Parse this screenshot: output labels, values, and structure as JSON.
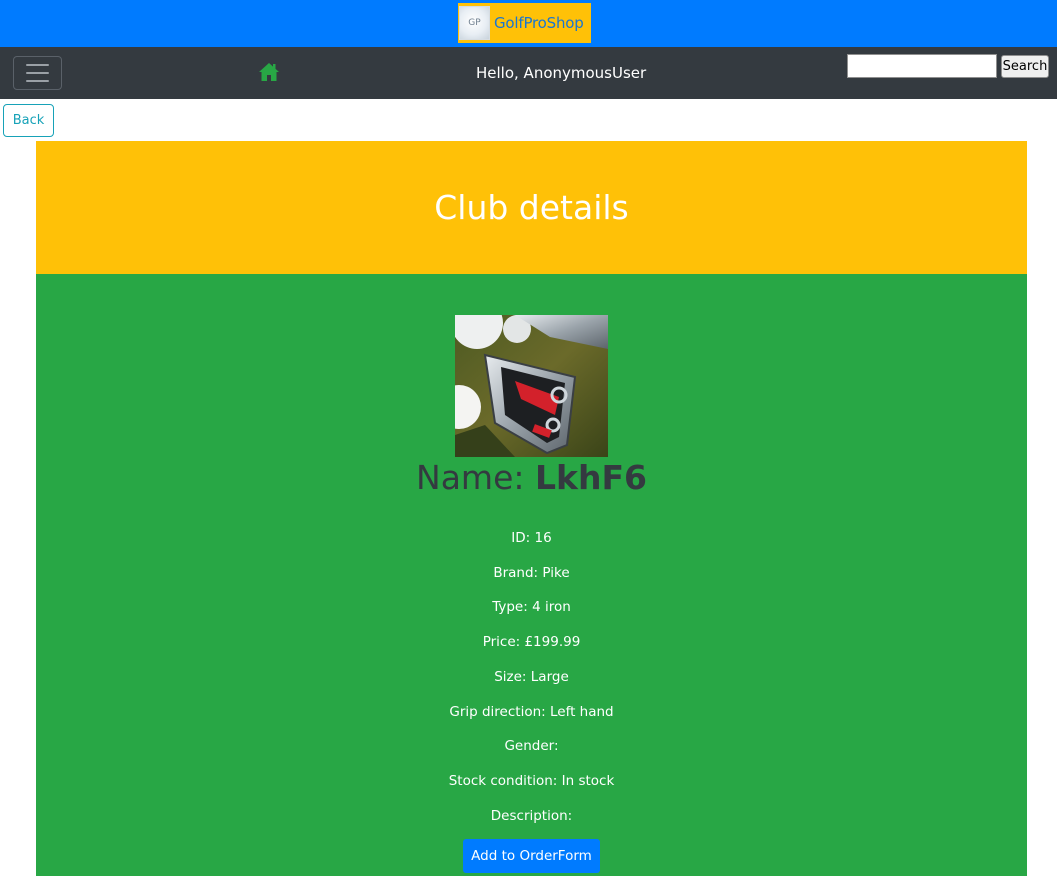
{
  "brand": {
    "logo_text": "GP",
    "name": "GolfProShop"
  },
  "navbar": {
    "greeting": "Hello, AnonymousUser",
    "search_placeholder": "",
    "search_label": "Search"
  },
  "back_label": "Back",
  "header": {
    "title": "Club details"
  },
  "club": {
    "name_label": "Name: ",
    "name_value": "LkhF6",
    "fields": {
      "id": "ID: 16",
      "brand": "Brand: Pike",
      "type": "Type: 4 iron",
      "price": "Price: £199.99",
      "size": "Size: Large",
      "grip": "Grip direction: Left hand",
      "gender": "Gender:",
      "stock": "Stock condition: In stock",
      "description": "Description:"
    },
    "add_label": "Add to OrderForm"
  },
  "colors": {
    "brand_bar": "#007bff",
    "navbar": "#343a40",
    "header_panel": "#ffc107",
    "details_panel": "#28a745",
    "home_icon": "#28a745",
    "back_accent": "#17a2b8"
  },
  "icons": {
    "menu": "hamburger-icon",
    "home": "home-icon"
  }
}
